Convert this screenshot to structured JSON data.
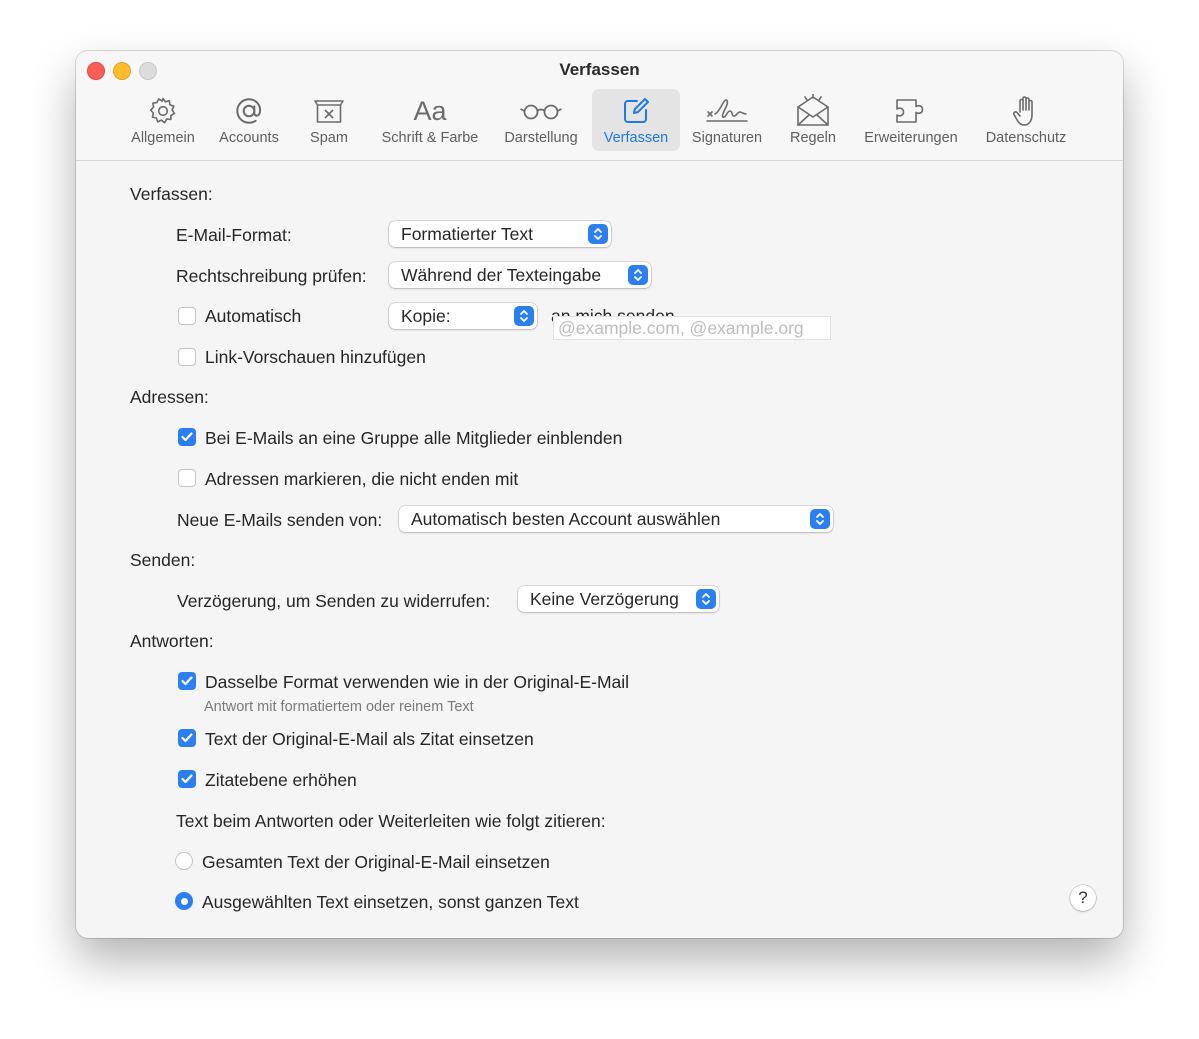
{
  "window": {
    "title": "Verfassen"
  },
  "tabs": [
    {
      "label": "Allgemein",
      "icon": "gear-icon"
    },
    {
      "label": "Accounts",
      "icon": "at-sign-icon"
    },
    {
      "label": "Spam",
      "icon": "junk-tray-icon"
    },
    {
      "label": "Schrift & Farbe",
      "icon": "font-aa-icon",
      "glyph": "Aa"
    },
    {
      "label": "Darstellung",
      "icon": "glasses-icon"
    },
    {
      "label": "Verfassen",
      "icon": "compose-icon",
      "active": true
    },
    {
      "label": "Signaturen",
      "icon": "signature-icon"
    },
    {
      "label": "Regeln",
      "icon": "envelope-rules-icon"
    },
    {
      "label": "Erweiterungen",
      "icon": "puzzle-icon"
    },
    {
      "label": "Datenschutz",
      "icon": "hand-icon"
    }
  ],
  "compose": {
    "header": "Verfassen:",
    "format_label": "E-Mail-Format:",
    "format_value": "Formatierter Text",
    "spell_label": "Rechtschreibung prüfen:",
    "spell_value": "Während der Texteingabe",
    "auto_label": "Automatisch",
    "auto_checked": false,
    "copy_value": "Kopie:",
    "copy_suffix": "an mich senden",
    "link_preview_label": "Link-Vorschauen hinzufügen",
    "link_preview_checked": false
  },
  "addresses": {
    "header": "Adressen:",
    "group_label": "Bei E-Mails an eine Gruppe alle Mitglieder einblenden",
    "group_checked": true,
    "mark_label": "Adressen markieren, die nicht enden mit",
    "mark_checked": false,
    "mark_placeholder": "@example.com, @example.org",
    "send_from_label": "Neue E-Mails senden von:",
    "send_from_value": "Automatisch besten Account auswählen"
  },
  "send": {
    "header": "Senden:",
    "delay_label": "Verzögerung, um Senden zu widerrufen:",
    "delay_value": "Keine Verzögerung"
  },
  "reply": {
    "header": "Antworten:",
    "same_format_label": "Dasselbe Format verwenden wie in der Original-E-Mail",
    "same_format_checked": true,
    "same_format_sub": "Antwort mit formatiertem oder reinem Text",
    "quote_label": "Text der Original-E-Mail als Zitat einsetzen",
    "quote_checked": true,
    "indent_label": "Zitatebene erhöhen",
    "indent_checked": true,
    "quote_mode_label": "Text beim Antworten oder Weiterleiten wie folgt zitieren:",
    "radio_all_label": "Gesamten Text der Original-E-Mail einsetzen",
    "radio_all_selected": false,
    "radio_selected_label": "Ausgewählten Text einsetzen, sonst ganzen Text",
    "radio_selected_selected": true
  },
  "help": {
    "label": "?"
  },
  "colors": {
    "accent": "#2c7ff0",
    "close": "#fe5f57",
    "minimize": "#febc2e",
    "zoom": "#dcdcdc"
  }
}
